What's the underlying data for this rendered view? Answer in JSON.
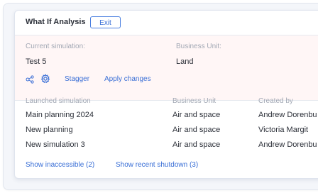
{
  "panel": {
    "title": "What If Analysis",
    "exit_label": "Exit"
  },
  "current": {
    "sim_label": "Current simulation:",
    "sim_value": "Test 5",
    "bu_label": "Business Unit:",
    "bu_value": "Land"
  },
  "actions": {
    "icons": [
      "share-nodes-icon",
      "gear-icon"
    ],
    "stagger_label": "Stagger",
    "apply_label": "Apply changes"
  },
  "table": {
    "headers": [
      "Launched simulation",
      "Business Unit",
      "Created by"
    ],
    "rows": [
      [
        "Main planning 2024",
        "Air and space",
        "Andrew Dorenbu"
      ],
      [
        "New planning",
        "Air and space",
        "Victoria Margit"
      ],
      [
        "New simulation 3",
        "Air and space",
        "Andrew Dorenbu"
      ]
    ]
  },
  "footer": {
    "inaccessible_label": "Show inaccessible (2)",
    "shutdown_label": "Show recent shutdown (3)"
  },
  "colors": {
    "accent": "#3a6fd6",
    "highlight_bg": "#fff6f6",
    "muted_text": "#a2a8b4"
  }
}
